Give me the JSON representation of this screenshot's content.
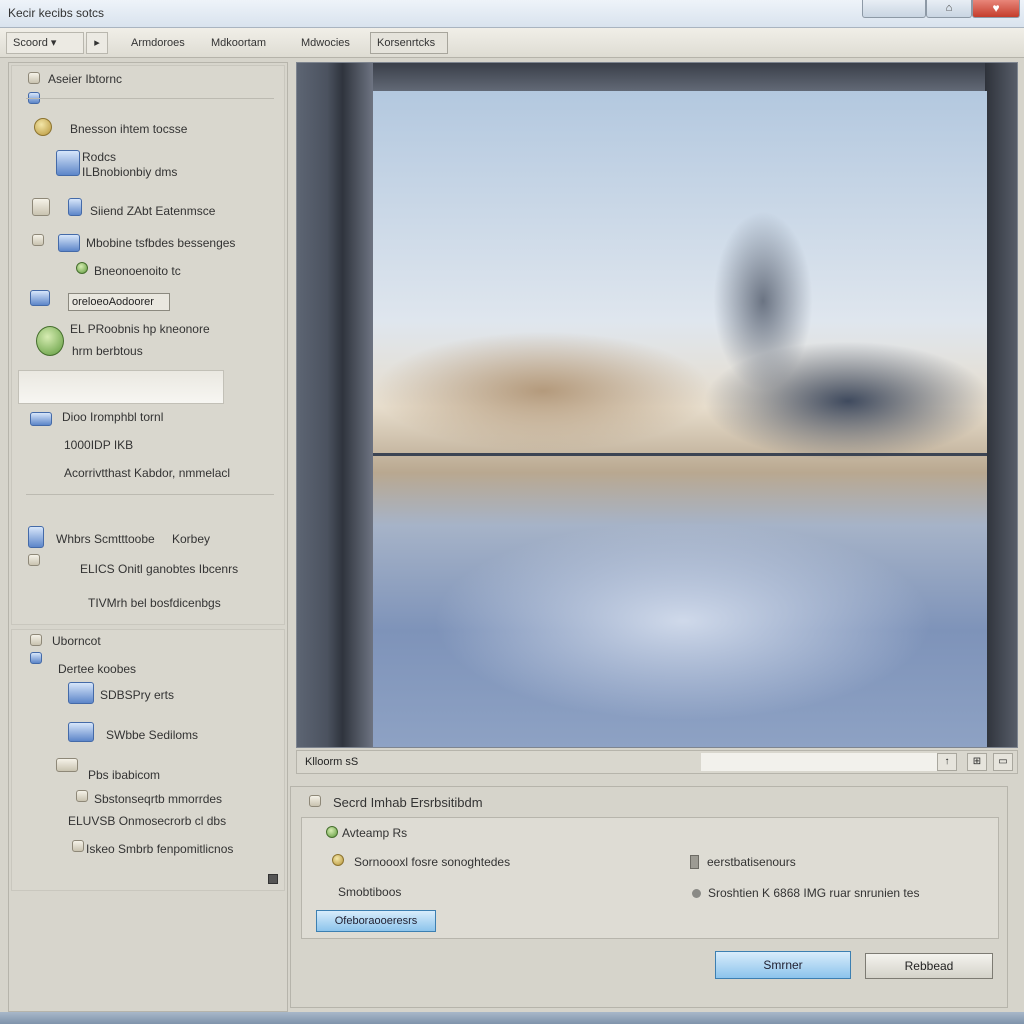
{
  "window": {
    "title": "Kecir kecibs sotcs",
    "maximize_glyph": "⌂",
    "close_glyph": "♥"
  },
  "toolbar": {
    "search_label": "Scoord ▾",
    "dropdown_glyph": "▸",
    "tabs": [
      "Armdoroes",
      "Mdkoortam",
      "Mdwocies",
      "Korsenrtcks"
    ]
  },
  "sidebar": {
    "header": "Aseier Ibtornc",
    "items": [
      {
        "label": "Bnesson ihtem tocsse"
      },
      {
        "label": "Rodcs"
      },
      {
        "label": "ILBnobionbiy dms"
      },
      {
        "label": "Siiend ZAbt Eatenmsce"
      },
      {
        "label": "Mbobine tsfbdes bessenges"
      },
      {
        "label": "Bneonoenoito tc"
      },
      {
        "label": "oreloeoAodoorer"
      },
      {
        "label": "EL PRoobnis hp kneonore"
      },
      {
        "label": "hrm berbtous"
      }
    ],
    "info": {
      "title": "Dioo Iromphbl tornl",
      "size": "1000IDP IKB",
      "desc": "Acorrivtthast Kabdor, nmmelacl"
    },
    "section2": {
      "title": "Whbrs Scmtttoobe",
      "badge": "Korbey",
      "line1": "ELICS Onitl ganobtes Ibcenrs",
      "line2": "TIVMrh bel bosfdicenbgs"
    },
    "tree": {
      "root": "Uborncot",
      "child": "Dertee koobes",
      "items": [
        "SDBSPry erts",
        "SWbbe Sediloms",
        "Pbs ibabicom",
        "Sbstonseqrtb mmorrdes",
        "ELUVSB Onmosecrorb cl dbs",
        "Iskeo Smbrb fenpomitlicnos"
      ]
    }
  },
  "preview": {
    "status_label": "Klloorm sS",
    "icons": [
      "↑",
      "⊞",
      "▭"
    ]
  },
  "options": {
    "header": "Secrd Imhab Ersrbsitibdm",
    "group_title": "Avteamp Rs",
    "opt1": "Sornoooxl fosre sonoghtedes",
    "opt2": "Smobtiboos",
    "opt3": "eerstbatisenours",
    "opt4": "Sroshtien K 6868 IMG ruar snrunien tes",
    "blue_button": "Ofeboraooeresrs"
  },
  "footer": {
    "ok_button": "Smrner",
    "cancel_button": "Rebbead"
  }
}
